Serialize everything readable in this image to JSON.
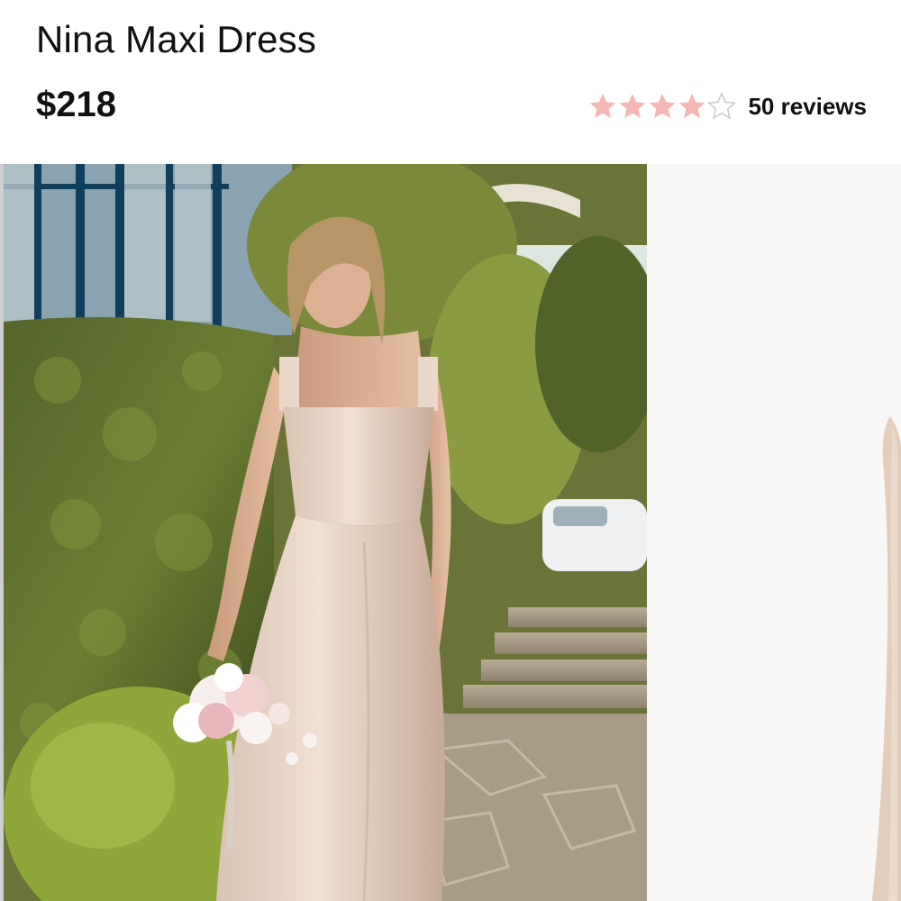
{
  "product": {
    "title": "Nina Maxi Dress",
    "price": "$218",
    "rating": 4,
    "rating_max": 5,
    "reviews_label": "50 reviews"
  },
  "colors": {
    "star_filled": "#f5b7b3",
    "star_empty": "#c9c9c9",
    "text": "#111111"
  },
  "icons": {
    "star": "star-icon",
    "star_empty": "star-outline-icon"
  },
  "images": [
    {
      "name": "product-photo-main",
      "subject": "model in satin maxi dress holding bouquet in garden"
    },
    {
      "name": "product-photo-secondary",
      "subject": "dress on light background, partially visible"
    }
  ]
}
